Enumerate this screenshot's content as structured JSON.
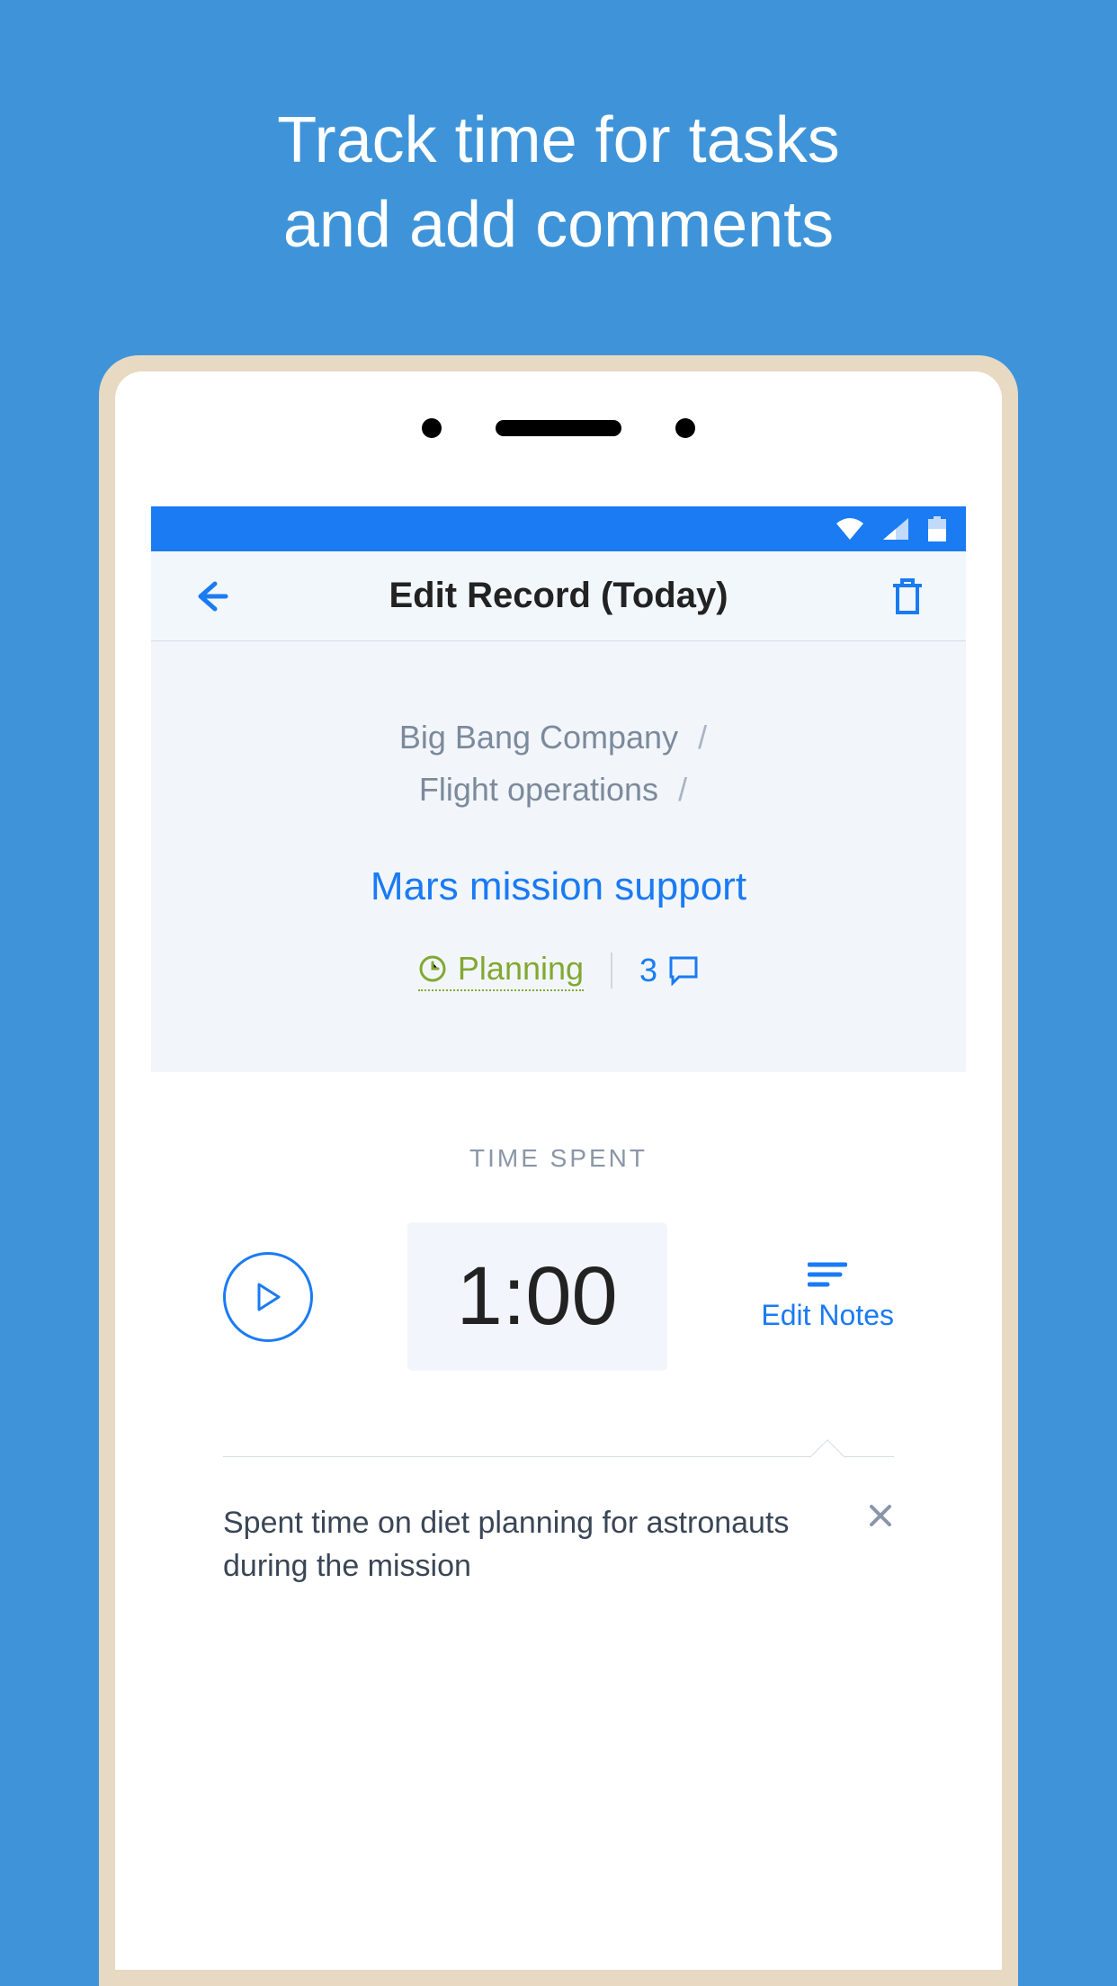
{
  "promo": {
    "line1": "Track time for tasks",
    "line2": "and add comments"
  },
  "header": {
    "title": "Edit Record (Today)"
  },
  "breadcrumb": {
    "level1": "Big Bang Company",
    "level2": "Flight operations"
  },
  "task": {
    "name": "Mars mission support",
    "status": "Planning",
    "comments_count": "3"
  },
  "time": {
    "label": "TIME SPENT",
    "value": "1:00",
    "edit_notes_label": "Edit Notes"
  },
  "note": {
    "text": "Spent time on diet planning for astronauts during the mission"
  }
}
